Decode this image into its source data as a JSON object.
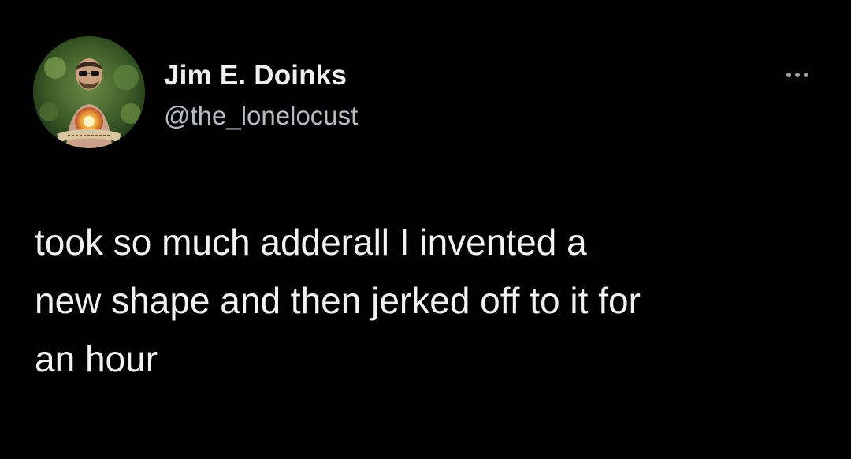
{
  "tweet": {
    "author": {
      "display_name": "Jim E. Doinks",
      "handle": "@the_lonelocust",
      "avatar_icon": "user-avatar-photo"
    },
    "more_icon": "more-options-icon",
    "text_lines": [
      "took so much adderall I invented a",
      "new shape and then jerked off to it for",
      "an hour"
    ]
  },
  "colors": {
    "background": "#000000",
    "name": "#f0f0f0",
    "handle": "#b8bcc0",
    "body_text": "#f2f2f2"
  }
}
